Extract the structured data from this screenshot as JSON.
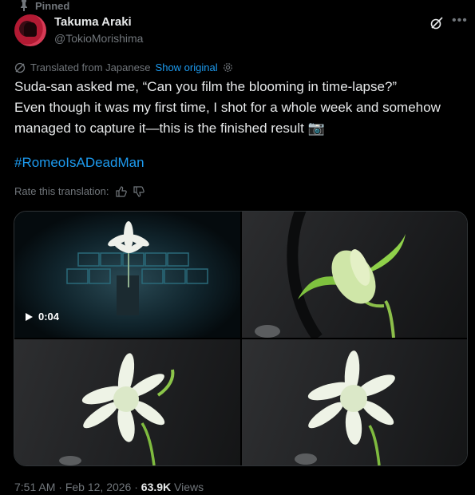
{
  "pinned_label": "Pinned",
  "author": {
    "name": "Takuma Araki",
    "handle": "@TokioMorishima"
  },
  "icons": {
    "pin": "pin-icon",
    "grok": "grok-icon",
    "more": "more-icon",
    "translate": "translate-icon",
    "settings": "settings-icon",
    "thumbs_up": "thumbs-up-icon",
    "thumbs_down": "thumbs-down-icon",
    "play": "play-icon"
  },
  "translation": {
    "label": "Translated from Japanese",
    "show_original": "Show original"
  },
  "post": {
    "lines": [
      "Suda-san asked me, “Can you film the blooming in time-lapse?”",
      "Even though it was my first time, I shot for a whole week and somehow",
      "managed to capture it—this is the finished result 📷"
    ],
    "hashtag": "#RomeoIsADeadMan"
  },
  "rate_label": "Rate this translation:",
  "media": {
    "video_duration": "0:04"
  },
  "footer": {
    "time": "7:51 AM",
    "sep1": " · ",
    "date": "Feb 12, 2026",
    "sep2": " · ",
    "views_count": "63.9K",
    "views_label": " Views"
  },
  "colors": {
    "accent": "#1d9bf0",
    "muted": "#71767b",
    "text": "#e7e9ea",
    "background": "#000000"
  }
}
